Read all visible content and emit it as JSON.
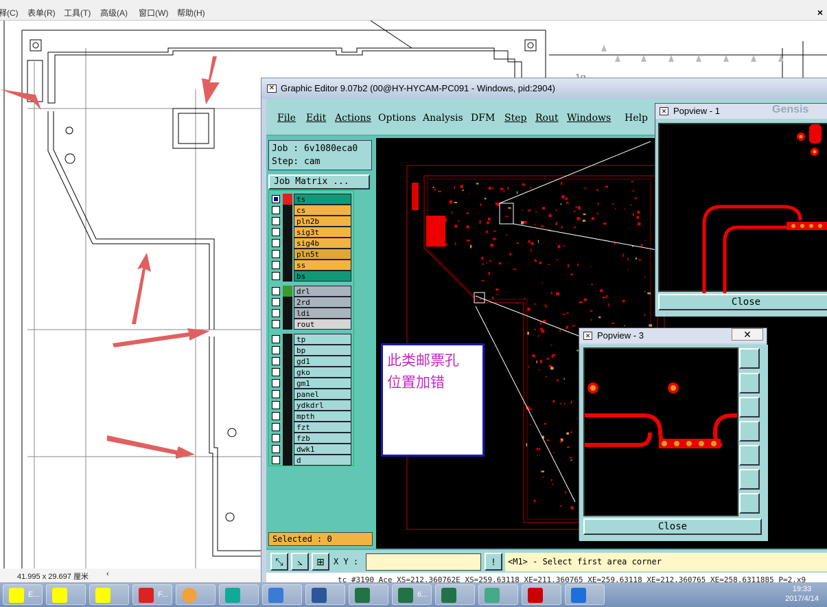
{
  "bg_app": {
    "menu": [
      "释(C)",
      "表单(R)",
      "工具(T)",
      "高级(A)",
      "窗口(W)",
      "帮助(H)"
    ],
    "close_glyph": "×",
    "status": "41.995 x 29.697 厘米",
    "scroll_arrow": "‹",
    "ruler_label": "1g"
  },
  "editor": {
    "title": "Graphic Editor 9.07b2 (00@HY-HYCAM-PC091 - Windows, pid:2904)",
    "menu": [
      "File",
      "Edit",
      "Actions",
      "Options",
      "Analysis",
      "DFM",
      "Step",
      "Rout",
      "Windows",
      "Help"
    ],
    "job_line": "Job : 6v1080eca0",
    "step_line": "Step: cam",
    "job_matrix_label": "Job Matrix ...",
    "selected_label": "Selected : 0",
    "xy_label": "X Y :",
    "message": "<M1> - Select first area corner",
    "cmdline": "tc #3190 Ace XS=212.360762E XS=259.63118 XE=211.360765 XE=259.63118 XE=212.360765 XE=258.6311885 P=2.x9"
  },
  "layers": {
    "board": [
      {
        "name": "ts",
        "color": "#119977",
        "active": true
      },
      {
        "name": "cs",
        "color": "#f2b441"
      },
      {
        "name": "pln2b",
        "color": "#f2b441"
      },
      {
        "name": "sig3t",
        "color": "#f2b441"
      },
      {
        "name": "sig4b",
        "color": "#f2b441"
      },
      {
        "name": "pln5t",
        "color": "#e0a832"
      },
      {
        "name": "ss",
        "color": "#f2b441"
      },
      {
        "name": "bs",
        "color": "#119977"
      }
    ],
    "drill": [
      {
        "name": "drl",
        "color": "#a9b4bd"
      },
      {
        "name": "2rd",
        "color": "#a9b4bd"
      },
      {
        "name": "ldi",
        "color": "#a9b4bd"
      },
      {
        "name": "rout",
        "color": "#d6d6d6"
      }
    ],
    "misc": [
      {
        "name": "tp",
        "color": "#a4d9d7"
      },
      {
        "name": "bp",
        "color": "#a4d9d7"
      },
      {
        "name": "gd1",
        "color": "#a4d9d7"
      },
      {
        "name": "gko",
        "color": "#a4d9d7"
      },
      {
        "name": "gm1",
        "color": "#a4d9d7"
      },
      {
        "name": "panel",
        "color": "#a4d9d7"
      },
      {
        "name": "ydkdrl",
        "color": "#a4d9d7"
      },
      {
        "name": "mpth",
        "color": "#a4d9d7"
      },
      {
        "name": "fzt",
        "color": "#a4d9d7"
      },
      {
        "name": "fzb",
        "color": "#a4d9d7"
      },
      {
        "name": "dwk1",
        "color": "#a4d9d7"
      },
      {
        "name": "d",
        "color": "#a4d9d7"
      }
    ]
  },
  "annotation": {
    "line1": "此类邮票孔",
    "line2": "位置加错"
  },
  "popview1": {
    "title": "Popview - 1",
    "close": "Close",
    "watermark": "Gensis"
  },
  "popview3": {
    "title": "Popview - 3",
    "close": "Close",
    "close_glyph": "✕"
  },
  "taskbar": {
    "items": [
      "E...",
      "",
      "",
      "F...",
      "",
      "",
      "",
      "",
      "",
      "6...",
      "",
      "",
      "",
      "",
      ""
    ],
    "time": "19:33",
    "date": "2017/4/14"
  }
}
